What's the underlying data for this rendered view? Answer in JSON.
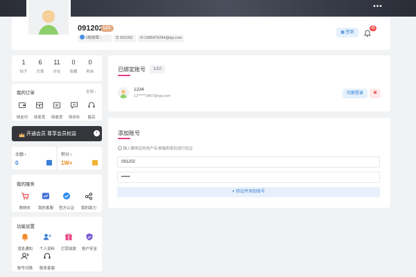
{
  "profile": {
    "username": "091202",
    "level": "LV1",
    "medals": "2枚勋章",
    "uid": "091202",
    "email": "1686476264@qq.com",
    "sign_label": "签到",
    "notif_count": "45"
  },
  "stats": [
    {
      "n": "1",
      "l": "帖子"
    },
    {
      "n": "6",
      "l": "文章"
    },
    {
      "n": "11",
      "l": "评论"
    },
    {
      "n": "0",
      "l": "收藏"
    },
    {
      "n": "0",
      "l": "粉丝"
    }
  ],
  "orders": {
    "title": "我的订单",
    "all": "全部",
    "items": [
      "待支付",
      "待发货",
      "待收货",
      "待评价",
      "售后"
    ]
  },
  "vip": {
    "label": "开通会员 尊享会员权益"
  },
  "balance": {
    "label": "余额",
    "value": "0"
  },
  "points": {
    "label": "积分",
    "value": "1W+"
  },
  "services": {
    "title": "我的服务",
    "items": [
      "购物车",
      "我的客服",
      "官方认证",
      "我的助力"
    ]
  },
  "settings": {
    "title": "功能设置",
    "items": [
      "消息通知",
      "个人资料",
      "打赏收款",
      "账户安全",
      "账号切换",
      "联系客服"
    ]
  },
  "bound": {
    "title": "已绑定账号",
    "count": "1/10",
    "account_name": "1234",
    "account_email": "12*****3467@qq.com",
    "switch_label": "切换登录",
    "delete_label": "✖"
  },
  "add": {
    "title": "添加账号",
    "hint": "输入要绑定的用户名/邮箱和密码进行验证",
    "username_value": "091202",
    "password_value": "••••••",
    "submit_label": "验证并添加账号"
  },
  "colors": {
    "accent_pink": "#e93883",
    "accent_blue": "#2d7fd2",
    "vip_bg": "#34363b"
  }
}
